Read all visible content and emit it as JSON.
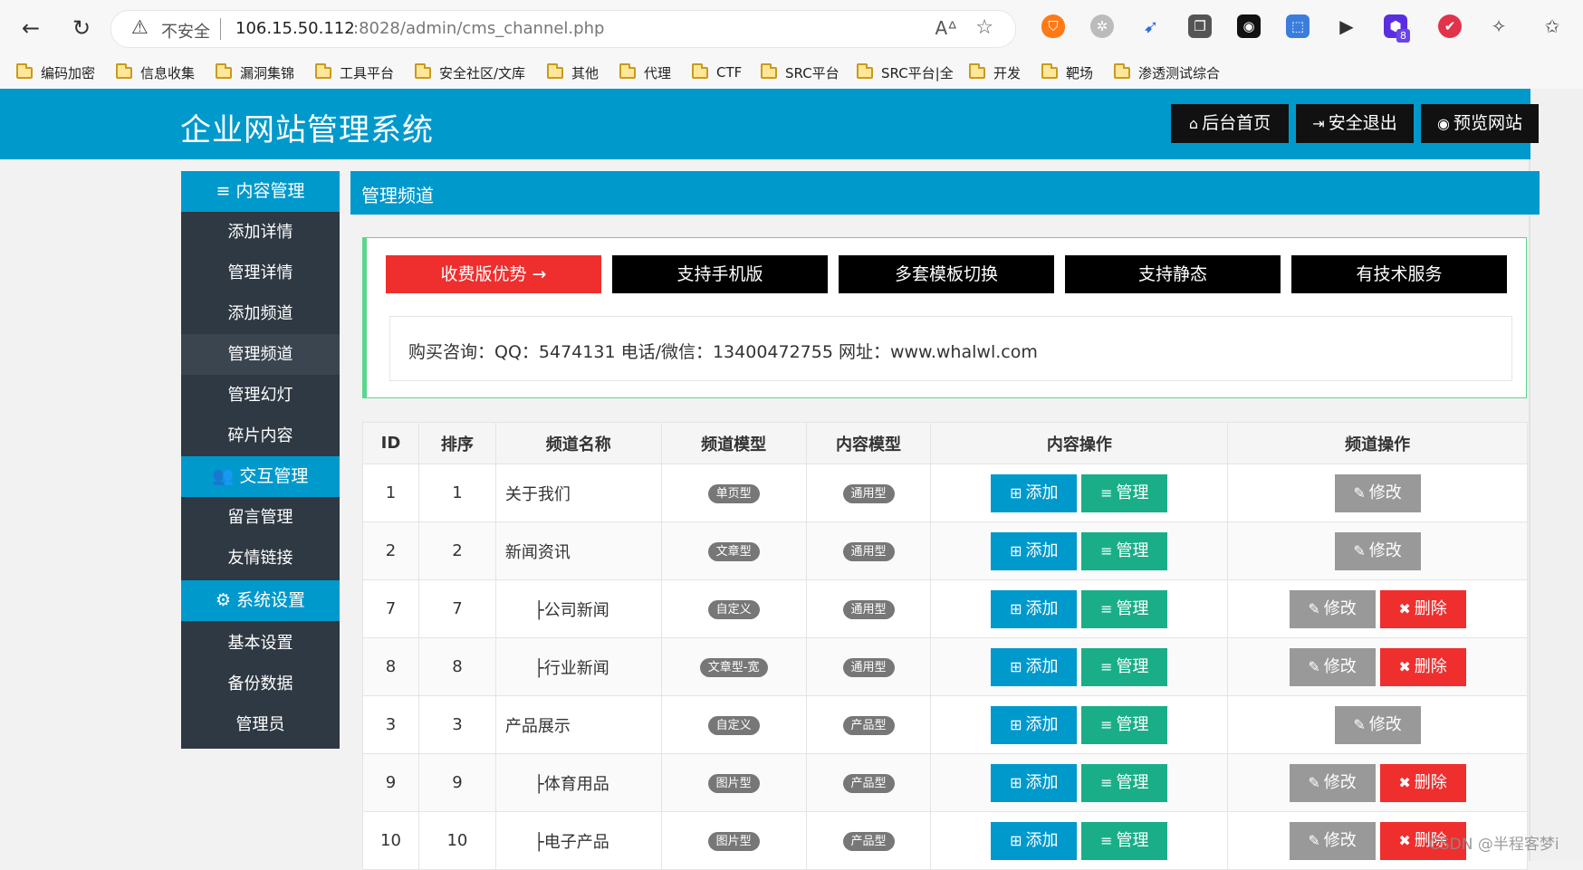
{
  "browser": {
    "not_secure": "不安全",
    "url_host": "106.15.50.112",
    "url_rest": ":8028/admin/cms_channel.php",
    "bookmarks": [
      "编码加密",
      "信息收集",
      "漏洞集锦",
      "工具平台",
      "安全社区/文库",
      "其他",
      "代理",
      "CTF",
      "SRC平台",
      "SRC平台|全",
      "开发",
      "靶场",
      "渗透测试综合"
    ],
    "ext_badge": "8"
  },
  "header": {
    "title": "企业网站管理系统",
    "buttons": [
      "后台首页",
      "安全退出",
      "预览网站"
    ]
  },
  "sidebar": {
    "sections": [
      {
        "label": "内容管理",
        "items": [
          "添加详情",
          "管理详情",
          "添加频道",
          "管理频道",
          "管理幻灯",
          "碎片内容"
        ]
      },
      {
        "label": "交互管理",
        "items": [
          "留言管理",
          "友情链接"
        ]
      },
      {
        "label": "系统设置",
        "items": [
          "基本设置",
          "备份数据",
          "管理员"
        ]
      }
    ],
    "active": "管理频道"
  },
  "main": {
    "title": "管理频道",
    "promo_buttons": [
      "收费版优势 →",
      "支持手机版",
      "多套模板切换",
      "支持静态",
      "有技术服务"
    ],
    "contact": "购买咨询：QQ：5474131   电话/微信：13400472755   网址：www.whalwl.com"
  },
  "table": {
    "headers": [
      "ID",
      "排序",
      "频道名称",
      "频道模型",
      "内容模型",
      "内容操作",
      "频道操作"
    ],
    "rows": [
      {
        "id": "1",
        "order": "1",
        "name": "关于我们",
        "channel_model": "单页型",
        "content_model": "通用型",
        "deletable": false,
        "child": false
      },
      {
        "id": "2",
        "order": "2",
        "name": "新闻资讯",
        "channel_model": "文章型",
        "content_model": "通用型",
        "deletable": false,
        "child": false
      },
      {
        "id": "7",
        "order": "7",
        "name": "├公司新闻",
        "channel_model": "自定义",
        "content_model": "通用型",
        "deletable": true,
        "child": true
      },
      {
        "id": "8",
        "order": "8",
        "name": "├行业新闻",
        "channel_model": "文章型-宽",
        "content_model": "通用型",
        "deletable": true,
        "child": true
      },
      {
        "id": "3",
        "order": "3",
        "name": "产品展示",
        "channel_model": "自定义",
        "content_model": "产品型",
        "deletable": false,
        "child": false
      },
      {
        "id": "9",
        "order": "9",
        "name": "├体育用品",
        "channel_model": "图片型",
        "content_model": "产品型",
        "deletable": true,
        "child": true
      },
      {
        "id": "10",
        "order": "10",
        "name": "├电子产品",
        "channel_model": "图片型",
        "content_model": "产品型",
        "deletable": true,
        "child": true
      }
    ],
    "action_labels": {
      "add": "添加",
      "manage": "管理",
      "edit": "修改",
      "delete": "删除"
    }
  },
  "watermark": "CSDN @半程客梦i"
}
